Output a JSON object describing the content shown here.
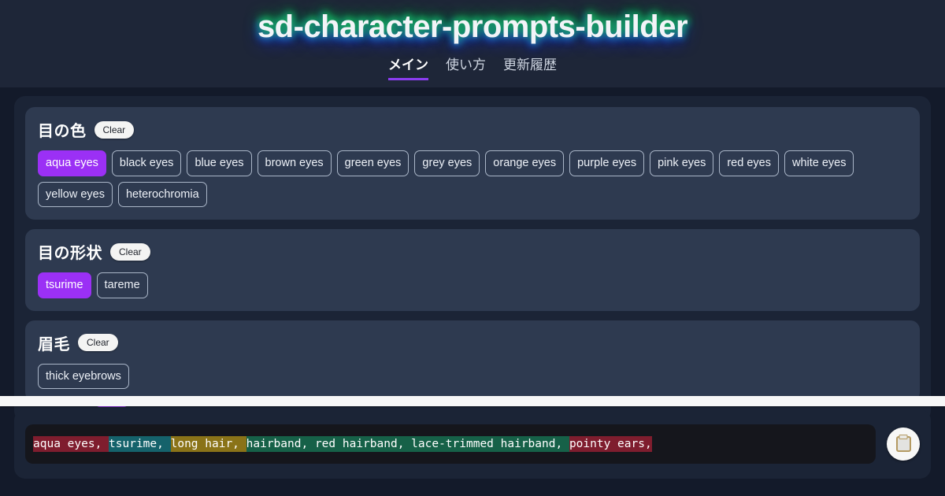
{
  "header": {
    "title": "sd-character-prompts-builder",
    "tabs": [
      {
        "label": "メイン",
        "active": true
      },
      {
        "label": "使い方",
        "active": false
      },
      {
        "label": "更新履歴",
        "active": false
      }
    ]
  },
  "cards": [
    {
      "title": "目の色",
      "clear_label": "Clear",
      "chips": [
        {
          "label": "aqua eyes",
          "selected": true
        },
        {
          "label": "black eyes",
          "selected": false
        },
        {
          "label": "blue eyes",
          "selected": false
        },
        {
          "label": "brown eyes",
          "selected": false
        },
        {
          "label": "green eyes",
          "selected": false
        },
        {
          "label": "grey eyes",
          "selected": false
        },
        {
          "label": "orange eyes",
          "selected": false
        },
        {
          "label": "purple eyes",
          "selected": false
        },
        {
          "label": "pink eyes",
          "selected": false
        },
        {
          "label": "red eyes",
          "selected": false
        },
        {
          "label": "white eyes",
          "selected": false
        },
        {
          "label": "yellow eyes",
          "selected": false
        },
        {
          "label": "heterochromia",
          "selected": false
        }
      ]
    },
    {
      "title": "目の形状",
      "clear_label": "Clear",
      "chips": [
        {
          "label": "tsurime",
          "selected": true
        },
        {
          "label": "tareme",
          "selected": false
        }
      ]
    },
    {
      "title": "眉毛",
      "clear_label": "Clear",
      "chips": [
        {
          "label": "thick eyebrows",
          "selected": false
        }
      ]
    }
  ],
  "output": {
    "copy_icon": "clipboard-icon",
    "segments": [
      {
        "text": "aqua eyes, ",
        "color": "#7f1d2e"
      },
      {
        "text": "tsurime, ",
        "color": "#15626b"
      },
      {
        "text": "long hair, ",
        "color": "#8a7318"
      },
      {
        "text": "hairband, red hairband, lace-trimmed hairband, ",
        "color": "#166148"
      },
      {
        "text": "pointy ears,",
        "color": "#7f1d2e"
      }
    ]
  },
  "colors": {
    "page_bg": "#131a2a",
    "header_bg": "#1e2638",
    "panel_bg": "#1b2436",
    "card_bg": "#2e3a50",
    "accent_purple": "#9b30f5",
    "tab_underline": "#8b3df0",
    "divider_white": "#f7f7f7",
    "output_bg": "#15161c"
  }
}
